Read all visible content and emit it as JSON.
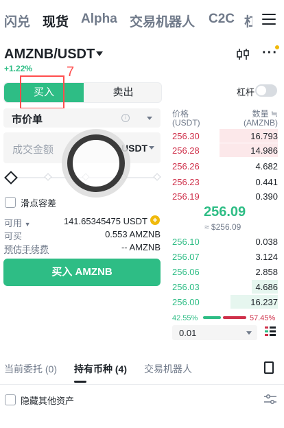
{
  "top_tabs": [
    "闪兑",
    "现货",
    "Alpha",
    "交易机器人",
    "C2C",
    "杠"
  ],
  "active_tab_index": 1,
  "pair": {
    "symbol": "AMZNB/USDT",
    "change": "+1.22%"
  },
  "trade_side": {
    "buy_label": "买入",
    "sell_label": "卖出",
    "active": "buy"
  },
  "annotation_number": "7",
  "margin_label": "杠杆",
  "order_type": "市价单",
  "amount": {
    "placeholder": "成交金额",
    "currency": "USDT"
  },
  "slippage_label": "滑点容差",
  "balances": [
    {
      "label": "可用",
      "value": "141.65345475 USDT"
    },
    {
      "label": "可买",
      "value": "0.553 AMZNB"
    },
    {
      "label": "预估手续费",
      "value": "-- AMZNB"
    }
  ],
  "buy_button": "买入 AMZNB",
  "orderbook": {
    "price_header": "价格",
    "price_unit": "(USDT)",
    "qty_header": "数量 ≒",
    "qty_unit": "(AMZNB)",
    "asks": [
      {
        "price": "256.30",
        "qty": "16.793",
        "depth": 0.55
      },
      {
        "price": "256.28",
        "qty": "14.986",
        "depth": 0.55
      },
      {
        "price": "256.26",
        "qty": "4.682",
        "depth": 0.0
      },
      {
        "price": "256.23",
        "qty": "0.441",
        "depth": 0.0
      },
      {
        "price": "256.19",
        "qty": "0.390",
        "depth": 0.0
      }
    ],
    "mid_price": "256.09",
    "mid_price_usd": "≈ $256.09",
    "bids": [
      {
        "price": "256.10",
        "qty": "0.038",
        "depth": 0.0
      },
      {
        "price": "256.07",
        "qty": "3.124",
        "depth": 0.0
      },
      {
        "price": "256.06",
        "qty": "2.858",
        "depth": 0.0
      },
      {
        "price": "256.03",
        "qty": "4.686",
        "depth": 0.25
      },
      {
        "price": "256.00",
        "qty": "16.237",
        "depth": 0.45
      }
    ],
    "buy_ratio": "42.55%",
    "sell_ratio": "57.45%",
    "depth_value": "0.01"
  },
  "bottom_tabs": [
    "当前委托 (0)",
    "持有币种 (4)",
    "交易机器人"
  ],
  "bottom_active_index": 1,
  "hide_assets_label": "隐藏其他资产",
  "colors": {
    "green": "#2ebd85",
    "red": "#cf304a",
    "annotation": "#ff4d4d",
    "accent_yellow": "#f0b90b"
  }
}
